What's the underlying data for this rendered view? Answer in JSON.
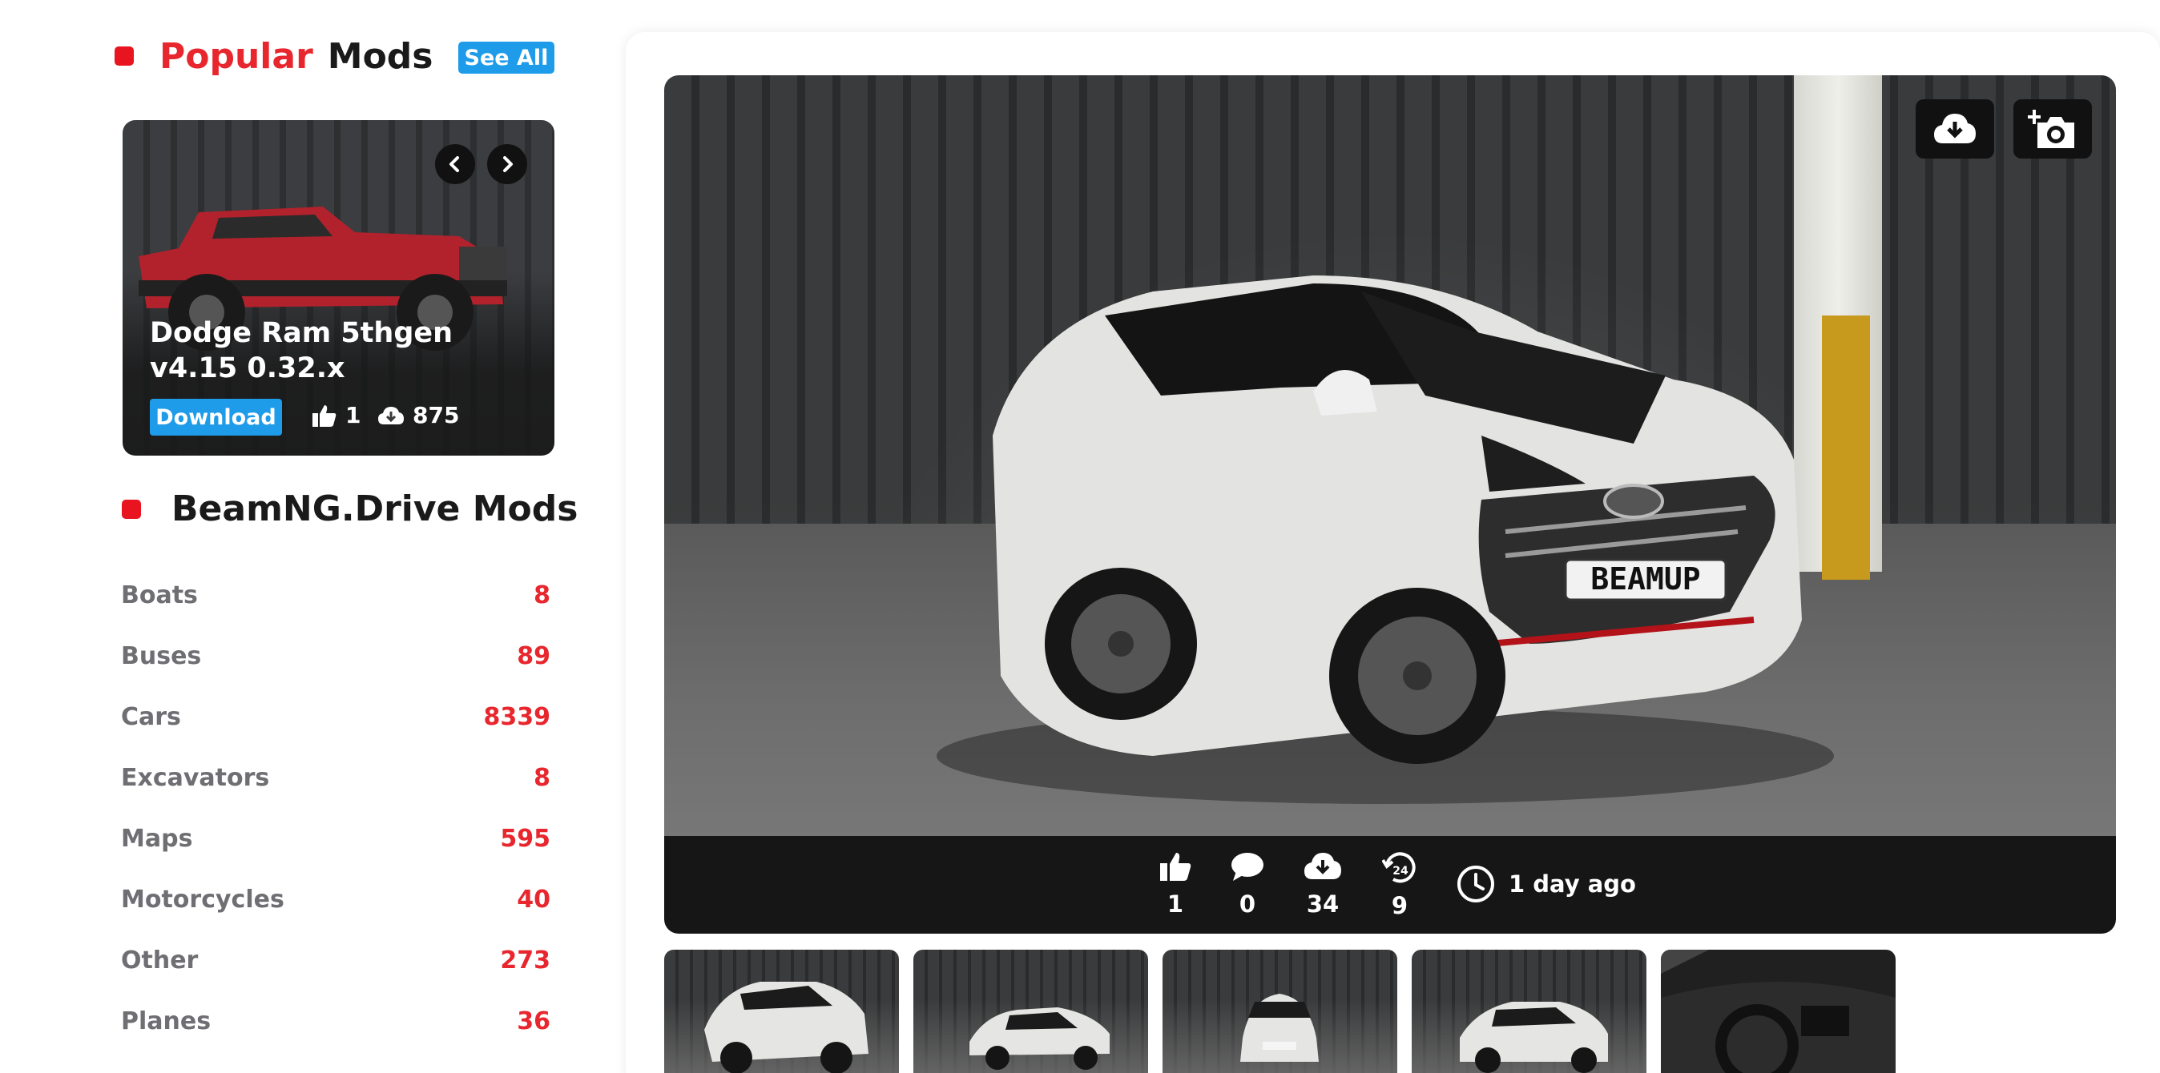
{
  "popular": {
    "title_highlight": "Popular",
    "title_rest": "Mods",
    "see_all_label": "See All",
    "card": {
      "title": "Dodge Ram 5thgen v4.15 0.32.x",
      "download_label": "Download",
      "likes": "1",
      "downloads": "875",
      "truck_color": "#b2222c"
    }
  },
  "category_section": {
    "title": "BeamNG.Drive Mods",
    "items": [
      {
        "name": "Boats",
        "count": "8"
      },
      {
        "name": "Buses",
        "count": "89"
      },
      {
        "name": "Cars",
        "count": "8339"
      },
      {
        "name": "Excavators",
        "count": "8"
      },
      {
        "name": "Maps",
        "count": "595"
      },
      {
        "name": "Motorcycles",
        "count": "40"
      },
      {
        "name": "Other",
        "count": "273"
      },
      {
        "name": "Planes",
        "count": "36"
      }
    ]
  },
  "mod": {
    "plate_text": "BEAMUP",
    "stats": {
      "likes": "1",
      "comments": "0",
      "downloads": "34",
      "downloads_24h": "9",
      "updated": "1 day ago"
    },
    "thumbnails": [
      "front-left",
      "side",
      "front",
      "rear-left",
      "interior"
    ]
  },
  "colors": {
    "accent_red": "#e8262d",
    "accent_blue": "#1e9be9",
    "stats_bar": "#161616"
  },
  "icons": {
    "download_action": "cloud-download-icon",
    "screenshot_action": "add-photo-icon",
    "likes": "thumbs-up-icon",
    "comments": "comment-icon",
    "downloads": "cloud-download-icon",
    "downloads_24h": "24h-history-icon",
    "updated": "clock-icon"
  }
}
